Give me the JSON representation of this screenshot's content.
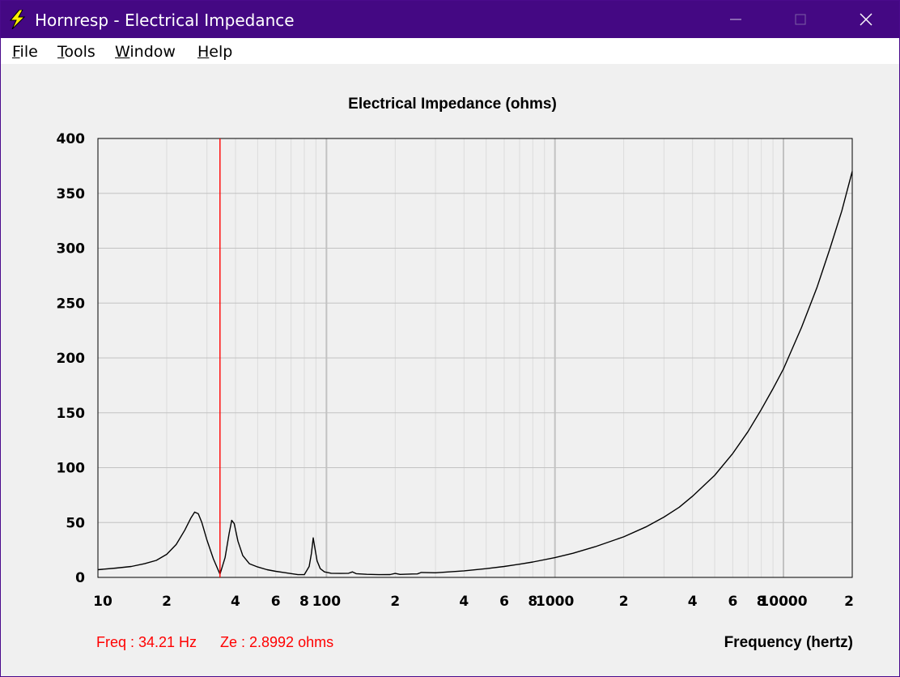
{
  "window": {
    "title": "Hornresp - Electrical Impedance",
    "app_icon": "lightning-bolt-icon",
    "controls": [
      "minimize-icon",
      "maximize-icon",
      "close-icon"
    ],
    "titlebar_color": "#440883"
  },
  "menu": {
    "items": [
      {
        "label_first": "F",
        "label_rest": "ile"
      },
      {
        "label_first": "T",
        "label_rest": "ools"
      },
      {
        "label_first": "W",
        "label_rest": "indow"
      },
      {
        "label_first": "H",
        "label_rest": "elp"
      }
    ]
  },
  "readout": {
    "freq": "Freq : 34.21 Hz",
    "ze": "Ze : 2.8992 ohms",
    "color": "#ff0000"
  },
  "chart_data": {
    "type": "line",
    "title": "Electrical Impedance (ohms)",
    "xlabel": "Frequency (hertz)",
    "ylabel": "",
    "xscale": "log",
    "xlim": [
      10,
      20000
    ],
    "ylim": [
      0,
      400
    ],
    "grid": true,
    "y_ticks": [
      {
        "value": 0,
        "label": "0"
      },
      {
        "value": 50,
        "label": "50"
      },
      {
        "value": 100,
        "label": "100"
      },
      {
        "value": 150,
        "label": "150"
      },
      {
        "value": 200,
        "label": "200"
      },
      {
        "value": 250,
        "label": "250"
      },
      {
        "value": 300,
        "label": "300"
      },
      {
        "value": 350,
        "label": "350"
      },
      {
        "value": 400,
        "label": "400"
      }
    ],
    "x_ticks": [
      {
        "value": 10,
        "label": "10"
      },
      {
        "value": 20,
        "label": "2"
      },
      {
        "value": 40,
        "label": "4"
      },
      {
        "value": 60,
        "label": "6"
      },
      {
        "value": 80,
        "label": "8"
      },
      {
        "value": 100,
        "label": "100"
      },
      {
        "value": 200,
        "label": "2"
      },
      {
        "value": 400,
        "label": "4"
      },
      {
        "value": 600,
        "label": "6"
      },
      {
        "value": 800,
        "label": "8"
      },
      {
        "value": 1000,
        "label": "1000"
      },
      {
        "value": 2000,
        "label": "2"
      },
      {
        "value": 4000,
        "label": "4"
      },
      {
        "value": 6000,
        "label": "6"
      },
      {
        "value": 8000,
        "label": "8"
      },
      {
        "value": 10000,
        "label": "10000"
      },
      {
        "value": 20000,
        "label": "2"
      }
    ],
    "cursor": {
      "x": 34.21,
      "color": "#ff0000"
    },
    "series": [
      {
        "color": "#000000",
        "x": [
          10,
          12,
          14,
          16,
          18,
          20,
          22,
          24,
          25.5,
          26.5,
          27.5,
          28.5,
          30,
          32,
          34.21,
          36,
          37.5,
          38.5,
          39.5,
          41,
          43,
          46,
          50,
          55,
          60,
          65,
          70,
          75,
          80,
          84,
          86,
          87.5,
          89,
          91,
          94,
          98,
          105,
          115,
          125,
          130,
          135,
          150,
          170,
          190,
          200,
          210,
          230,
          250,
          260,
          300,
          400,
          500,
          600,
          700,
          800,
          1000,
          1200,
          1500,
          2000,
          2500,
          3000,
          3500,
          4000,
          5000,
          6000,
          7000,
          8000,
          9000,
          10000,
          12000,
          14000,
          16000,
          18000,
          20000
        ],
        "y": [
          7,
          8.5,
          10,
          12.5,
          15.5,
          21,
          30,
          43,
          54,
          59.5,
          58,
          50,
          34,
          17,
          2.9,
          18,
          40,
          52,
          49,
          33,
          20,
          12.5,
          9.5,
          7,
          5.5,
          4.5,
          3.5,
          2.5,
          2.5,
          10,
          22,
          36,
          27,
          15,
          8,
          5,
          3.8,
          3.6,
          3.8,
          5,
          3.4,
          2.8,
          2.5,
          2.6,
          3.6,
          2.7,
          3,
          3.2,
          4.5,
          4.2,
          6,
          8,
          10,
          12,
          14,
          18,
          22,
          28,
          37,
          46,
          55,
          64,
          74,
          93,
          113,
          133,
          153,
          172,
          190,
          228,
          264,
          300,
          334,
          370
        ]
      }
    ]
  }
}
